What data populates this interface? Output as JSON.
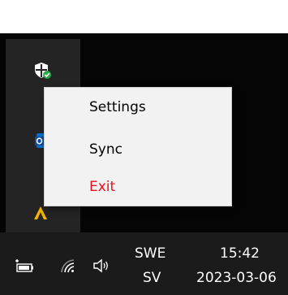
{
  "context_menu": {
    "items": [
      {
        "label": "Settings"
      },
      {
        "label": "Sync"
      },
      {
        "label": "Exit",
        "color": "#e81123"
      }
    ]
  },
  "tray_flyout": {
    "icons": [
      "defender-shield-icon",
      "outlook-icon",
      "yellow-app-icon"
    ]
  },
  "taskbar": {
    "language_top": "SWE",
    "language_bottom": "SV",
    "time": "15:42",
    "date": "2023-03-06",
    "icons": [
      "battery-icon",
      "wifi-icon",
      "speaker-icon"
    ]
  },
  "colors": {
    "menu_background": "#f2f2f2",
    "flyout_background": "#242424",
    "taskbar_background": "#1b1b1b",
    "exit_text": "#e81123",
    "shield_check": "#2aa84a",
    "outlook_blue": "#0a6ed1",
    "app_yellow": "#f5b400"
  }
}
